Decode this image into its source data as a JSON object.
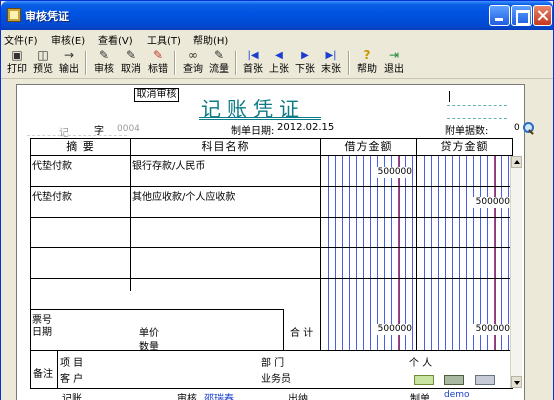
{
  "window": {
    "title": "审核凭证"
  },
  "menu": [
    "文件(F)",
    "审核(E)",
    "查看(V)",
    "工具(T)",
    "帮助(H)"
  ],
  "toolbar": [
    {
      "label": "打印",
      "icon": "printer-icon",
      "glyph": "▣"
    },
    {
      "label": "预览",
      "icon": "preview-icon",
      "glyph": "◫"
    },
    {
      "label": "输出",
      "icon": "export-icon",
      "glyph": "→"
    },
    {
      "label": "审核",
      "icon": "audit-icon",
      "glyph": "✎"
    },
    {
      "label": "取消",
      "icon": "cancel-audit-icon",
      "glyph": "✎"
    },
    {
      "label": "标错",
      "icon": "mark-error-icon",
      "glyph": "✎"
    },
    {
      "label": "查询",
      "icon": "binoculars-icon",
      "glyph": "∞"
    },
    {
      "label": "流量",
      "icon": "cashflow-icon",
      "glyph": "✎"
    },
    {
      "label": "首张",
      "icon": "first-page-icon",
      "glyph": "|◀"
    },
    {
      "label": "上张",
      "icon": "prev-page-icon",
      "glyph": "◀"
    },
    {
      "label": "下张",
      "icon": "next-page-icon",
      "glyph": "▶"
    },
    {
      "label": "末张",
      "icon": "last-page-icon",
      "glyph": "▶|"
    },
    {
      "label": "帮助",
      "icon": "help-icon",
      "glyph": "?"
    },
    {
      "label": "退出",
      "icon": "exit-icon",
      "glyph": "⇥"
    }
  ],
  "voucher": {
    "status_button": "取消审核",
    "title": "记账凭证",
    "type_label": "记",
    "number_label": "字",
    "number": "0004",
    "date_label": "制单日期:",
    "date": "2012.02.15",
    "attachments_label": "附单据数:",
    "attachments": "0",
    "headers": {
      "summary": "摘 要",
      "account": "科目名称",
      "debit": "借方金额",
      "credit": "贷方金额"
    },
    "rows": [
      {
        "summary": "代垫付款",
        "account": "银行存款/人民币",
        "debit": "500000",
        "credit": ""
      },
      {
        "summary": "代垫付款",
        "account": "其他应收款/个人应收款",
        "debit": "",
        "credit": "500000"
      }
    ],
    "totals": {
      "ticket_no": "票号",
      "date": "日期",
      "unit_price": "单价",
      "quantity": "数量",
      "label": "合 计",
      "debit": "500000",
      "credit": "500000"
    },
    "notes": {
      "label": "备注",
      "project": "项 目",
      "customer": "客 户",
      "department": "部 门",
      "salesperson": "业务员",
      "person": "个 人"
    },
    "footer": {
      "bookkeeper_label": "记账",
      "auditor_label": "审核",
      "auditor": "邵瑞春",
      "cashier_label": "出纳",
      "preparer_label": "制单",
      "preparer": "demo"
    }
  }
}
